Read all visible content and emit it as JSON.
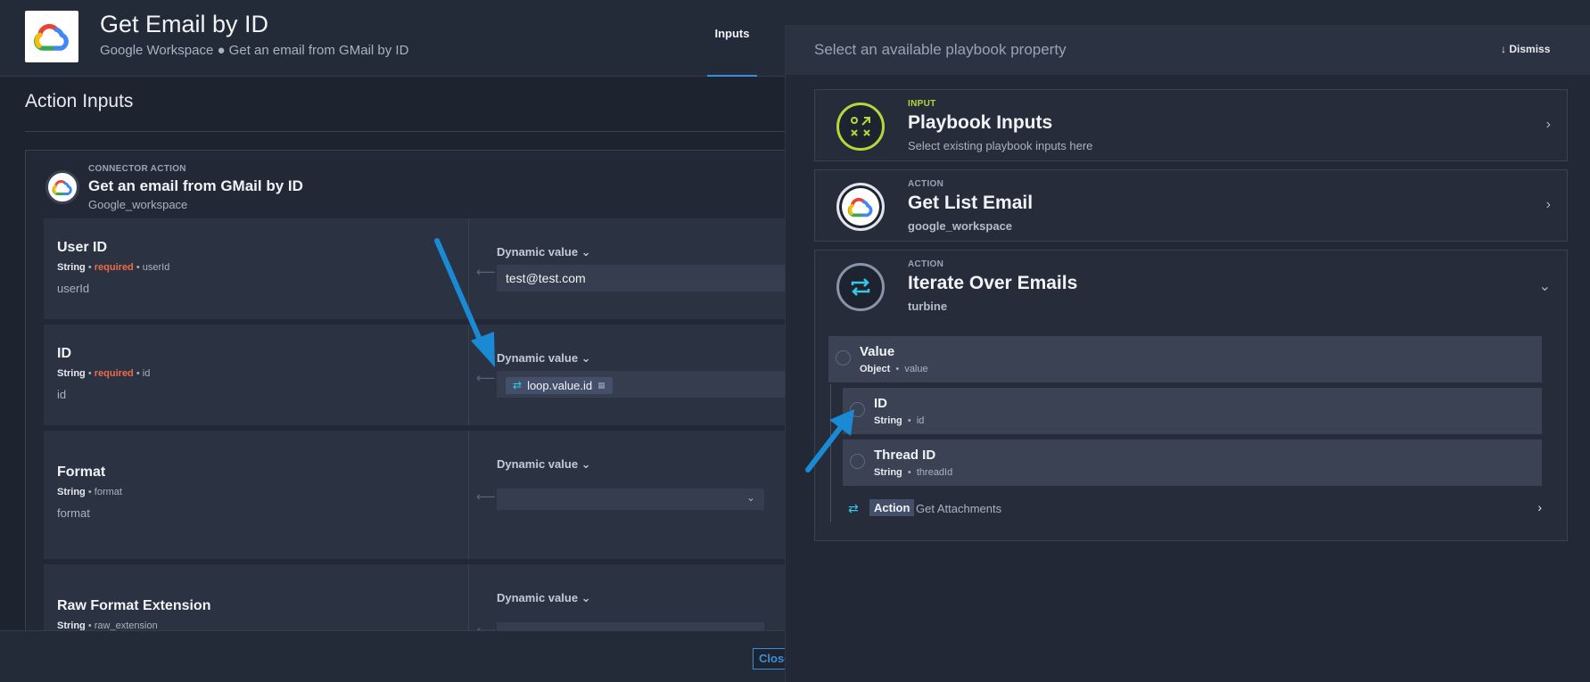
{
  "header": {
    "title": "Get Email by ID",
    "subtitle": "Google Workspace ● Get an email from GMail by ID",
    "tab_inputs": "Inputs"
  },
  "section": {
    "title": "Action Inputs"
  },
  "connector_action": {
    "label": "CONNECTOR ACTION",
    "title": "Get an email from GMail by ID",
    "subtitle": "Google_workspace"
  },
  "fields": [
    {
      "name": "User ID",
      "type": "String",
      "sep": "•",
      "required": "required",
      "key_meta": "userId",
      "key": "userId",
      "dynamic": "Dynamic value ⌄",
      "value": "test@test.com"
    },
    {
      "name": "ID",
      "type": "String",
      "sep": "•",
      "required": "required",
      "key_meta": "id",
      "key": "id",
      "dynamic": "Dynamic value ⌄",
      "chip": "loop.value.id"
    },
    {
      "name": "Format",
      "type": "String",
      "sep": "•",
      "key_meta": "format",
      "key": "format",
      "dynamic": "Dynamic value ⌄"
    },
    {
      "name": "Raw Format Extension",
      "type": "String",
      "sep": "•",
      "key_meta": "raw_extension",
      "dynamic": "Dynamic value ⌄"
    }
  ],
  "footer": {
    "close_label": "Close"
  },
  "overlay": {
    "title": "Select an available playbook property",
    "dismiss": "Dismiss",
    "cards": [
      {
        "kind": "INPUT",
        "title": "Playbook Inputs",
        "subtitle": "Select existing playbook inputs here",
        "icon": "playbook-inputs-icon"
      },
      {
        "kind": "ACTION",
        "title": "Get List Email",
        "subtitle": "google_workspace",
        "icon": "google-cloud-icon"
      },
      {
        "kind": "ACTION",
        "title": "Iterate Over Emails",
        "subtitle": "turbine",
        "icon": "loop-icon"
      }
    ],
    "properties": [
      {
        "name": "Value",
        "type": "Object",
        "key": "value"
      },
      {
        "name": "ID",
        "type": "String",
        "key": "id"
      },
      {
        "name": "Thread ID",
        "type": "String",
        "key": "threadId"
      }
    ],
    "subaction": {
      "badge": "Action",
      "text": "Get Attachments"
    }
  },
  "colors": {
    "accent": "#3b8ed8",
    "required": "#f06a4a",
    "input_green": "#b4d83a",
    "loop_cyan": "#35c8e8",
    "annotation_arrow": "#1a8ad4"
  }
}
